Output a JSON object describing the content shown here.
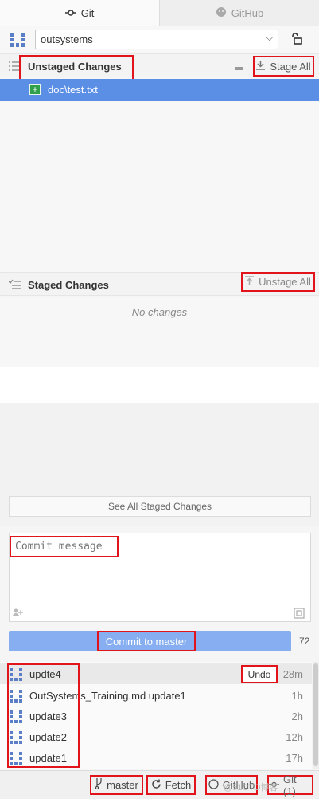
{
  "tabs": [
    {
      "label": "Git",
      "icon": "git-commit-icon",
      "active": true
    },
    {
      "label": "GitHub",
      "icon": "github-icon",
      "active": false
    }
  ],
  "repo": {
    "selected": "outsystems"
  },
  "unstaged": {
    "title": "Unstaged Changes",
    "stage_all_label": "Stage All",
    "files": [
      {
        "name": "doc\\test.txt",
        "status": "added"
      }
    ]
  },
  "staged": {
    "title": "Staged Changes",
    "unstage_all_label": "Unstage All",
    "empty_text": "No changes"
  },
  "see_all_label": "See All Staged Changes",
  "commit": {
    "placeholder": "Commit message",
    "button_label": "Commit to master",
    "char_count": "72"
  },
  "history": {
    "undo_label": "Undo",
    "items": [
      {
        "message": "updte4",
        "time": "28m"
      },
      {
        "message": "OutSystems_Training.md update1",
        "time": "1h"
      },
      {
        "message": "update3",
        "time": "2h"
      },
      {
        "message": "update2",
        "time": "12h"
      },
      {
        "message": "update1",
        "time": "17h"
      }
    ]
  },
  "status_bar": {
    "branch": "master",
    "fetch": "Fetch",
    "github": "GitHub",
    "git": "Git (1)",
    "watermark": "@51CTO博客"
  },
  "colors": {
    "accent": "#5b8fe6",
    "commit_button": "#86aef0",
    "highlight_box": "#e0141a",
    "added_file": "#2fa14a"
  }
}
